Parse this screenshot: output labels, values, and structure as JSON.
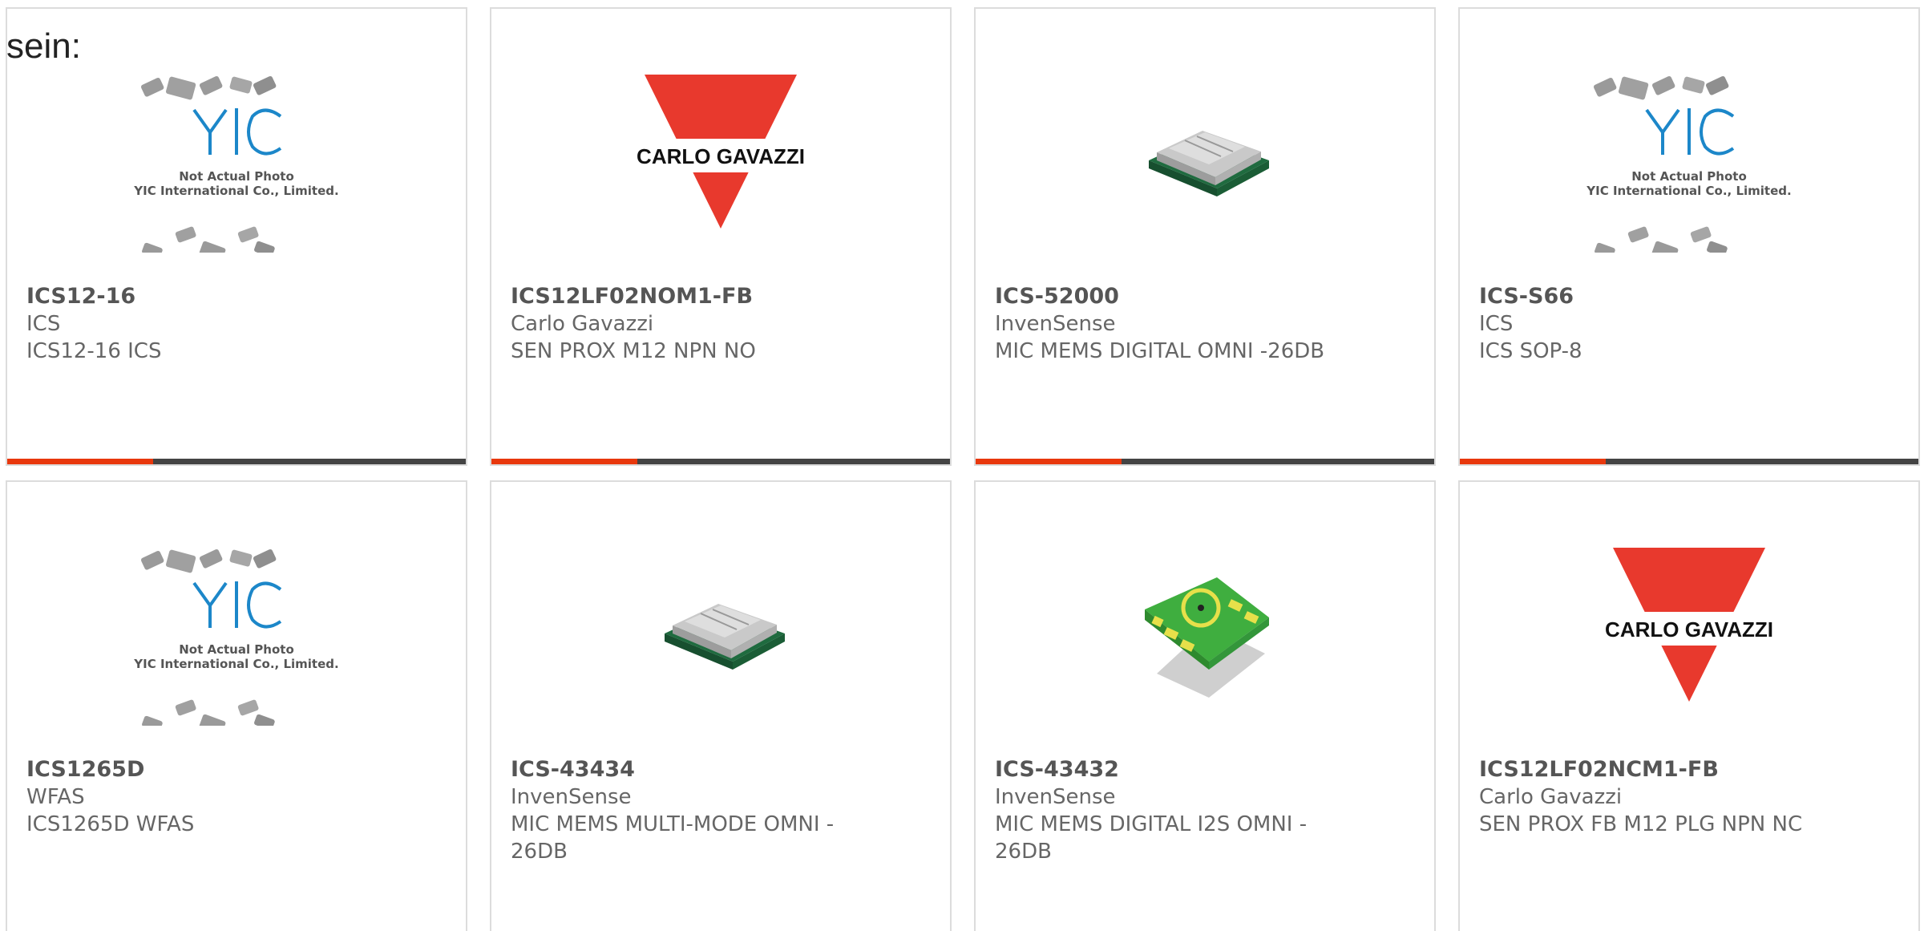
{
  "intro_text": "sein:",
  "colors": {
    "accent": "#e8380d",
    "bar": "#444444",
    "border": "#dcdcdc",
    "text": "#666666"
  },
  "products": [
    {
      "part": "ICS12-16",
      "maker": "ICS",
      "desc": "ICS12-16 ICS",
      "image": "yic-placeholder",
      "placeholder_line1": "Not Actual Photo",
      "placeholder_line2": "YIC International Co., Limited."
    },
    {
      "part": "ICS12LF02NOM1-FB",
      "maker": "Carlo Gavazzi",
      "desc": "SEN PROX M12 NPN NO",
      "image": "carlo-gavazzi-logo",
      "logo_text": "CARLO GAVAZZI"
    },
    {
      "part": "ICS-52000",
      "maker": "InvenSense",
      "desc": "MIC MEMS DIGITAL OMNI -26DB",
      "image": "mems-chip"
    },
    {
      "part": "ICS-S66",
      "maker": "ICS",
      "desc": "ICS SOP-8",
      "image": "yic-placeholder",
      "placeholder_line1": "Not Actual Photo",
      "placeholder_line2": "YIC International Co., Limited."
    },
    {
      "part": "ICS1265D",
      "maker": "WFAS",
      "desc": "ICS1265D WFAS",
      "image": "yic-placeholder",
      "placeholder_line1": "Not Actual Photo",
      "placeholder_line2": "YIC International Co., Limited."
    },
    {
      "part": "ICS-43434",
      "maker": "InvenSense",
      "desc": "MIC MEMS MULTI-MODE OMNI -\n26DB",
      "image": "mems-chip"
    },
    {
      "part": "ICS-43432",
      "maker": "InvenSense",
      "desc": "MIC MEMS DIGITAL I2S OMNI -\n26DB",
      "image": "green-pcb-mic"
    },
    {
      "part": "ICS12LF02NCM1-FB",
      "maker": "Carlo Gavazzi",
      "desc": "SEN PROX FB M12 PLG NPN NC",
      "image": "carlo-gavazzi-logo",
      "logo_text": "CARLO GAVAZZI"
    }
  ]
}
